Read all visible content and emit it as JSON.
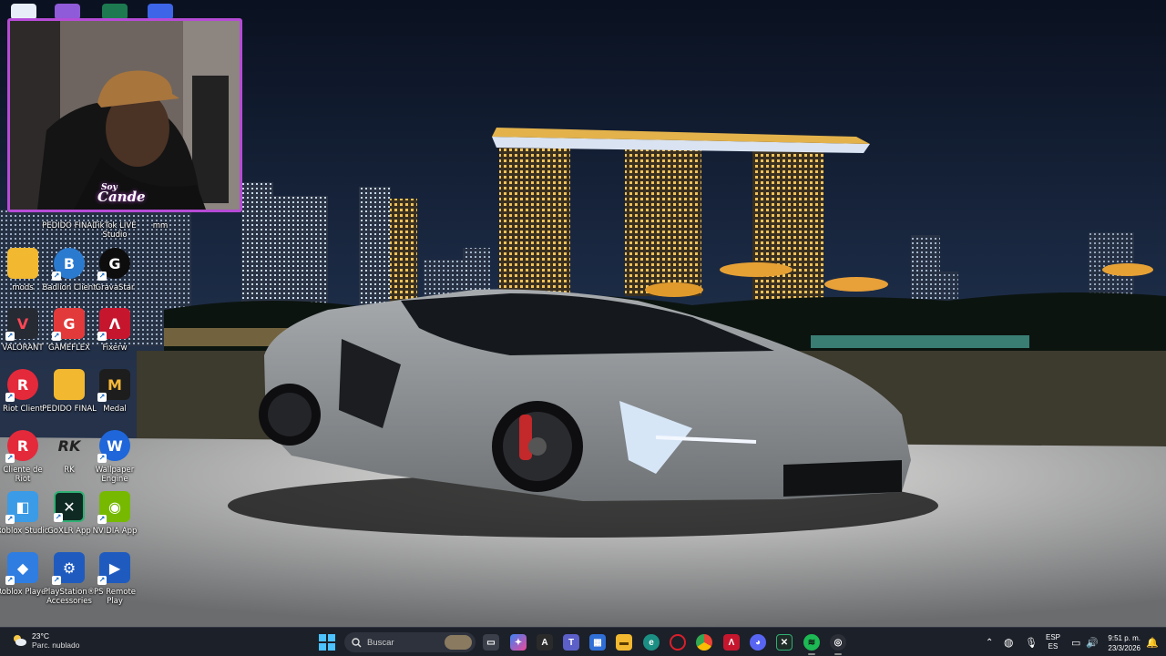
{
  "desktop": {
    "icons_row_top": [
      {
        "name": "pedido-final-top",
        "label": "PEDIDO FINAL"
      },
      {
        "name": "tiktok-live-studio",
        "label": "TikTok LIVE Studio"
      },
      {
        "name": "mm",
        "label": "mm"
      }
    ],
    "icons": [
      {
        "name": "mods",
        "label": "mods"
      },
      {
        "name": "badlion-client",
        "label": "Badlion Client"
      },
      {
        "name": "gravastar",
        "label": "GravaStar"
      },
      {
        "name": "valorant",
        "label": "VALORANT"
      },
      {
        "name": "gamemaster",
        "label": "GAMEFLEX"
      },
      {
        "name": "fixerw",
        "label": "Fixerw"
      },
      {
        "name": "riot-client",
        "label": "Riot Client"
      },
      {
        "name": "pedido-final",
        "label": "PEDIDO FINAL"
      },
      {
        "name": "medal",
        "label": "Medal"
      },
      {
        "name": "cliente-de-riot",
        "label": "Cliente de Riot"
      },
      {
        "name": "rk",
        "label": "RK"
      },
      {
        "name": "wallpaper-engine",
        "label": "Wallpaper Engine"
      },
      {
        "name": "roblox-studio",
        "label": "Roblox Studio"
      },
      {
        "name": "goxlr-app",
        "label": "GoXLR App"
      },
      {
        "name": "nvidia-app",
        "label": "NVIDIA App"
      },
      {
        "name": "roblox-player",
        "label": "Roblox Player"
      },
      {
        "name": "playstation-accessories",
        "label": "PlayStation® Accessories"
      },
      {
        "name": "ps-remote-play",
        "label": "PS Remote Play"
      }
    ]
  },
  "webcam": {
    "overlay_small": "Soy",
    "overlay_name": "Cande"
  },
  "taskbar": {
    "weather_temp": "23°C",
    "weather_desc": "Parc. nublado",
    "search_placeholder": "Buscar",
    "language_top": "ESP",
    "language_bottom": "ES",
    "time": "9:51 p. m.",
    "date": "23/3/2026"
  },
  "colors": {
    "webcam_border": "#b64bd6",
    "taskbar_bg": "#1c2029"
  }
}
